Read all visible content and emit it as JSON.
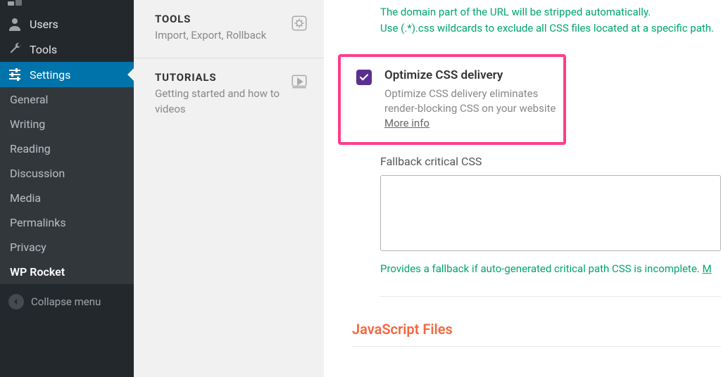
{
  "wpSidebar": {
    "partial_item": {
      "label": "",
      "icon": "gauge"
    },
    "menu": [
      {
        "label": "Users",
        "icon": "user"
      },
      {
        "label": "Tools",
        "icon": "wrench"
      },
      {
        "label": "Settings",
        "icon": "sliders",
        "active": true
      }
    ],
    "subMenu": [
      {
        "label": "General"
      },
      {
        "label": "Writing"
      },
      {
        "label": "Reading"
      },
      {
        "label": "Discussion"
      },
      {
        "label": "Media"
      },
      {
        "label": "Permalinks"
      },
      {
        "label": "Privacy"
      },
      {
        "label": "WP Rocket",
        "active": true
      }
    ],
    "collapse": "Collapse menu"
  },
  "secondary": {
    "tools": {
      "title": "TOOLS",
      "desc": "Import, Export, Rollback"
    },
    "tutorials": {
      "title": "TUTORIALS",
      "desc": "Getting started and how to videos"
    }
  },
  "main": {
    "hint1": "The domain part of the URL will be stripped automatically.",
    "hint2": "Use (.*).css wildcards to exclude all CSS files located at a specific path.",
    "optimize": {
      "label": "Optimize CSS delivery",
      "desc": "Optimize CSS delivery eliminates render-blocking CSS on your website",
      "more": "More info"
    },
    "fallback": {
      "label": "Fallback critical CSS",
      "value": "",
      "hint": "Provides a fallback if auto-generated critical path CSS is incomplete. ",
      "hintLink": "M"
    },
    "jsSection": "JavaScript Files"
  }
}
